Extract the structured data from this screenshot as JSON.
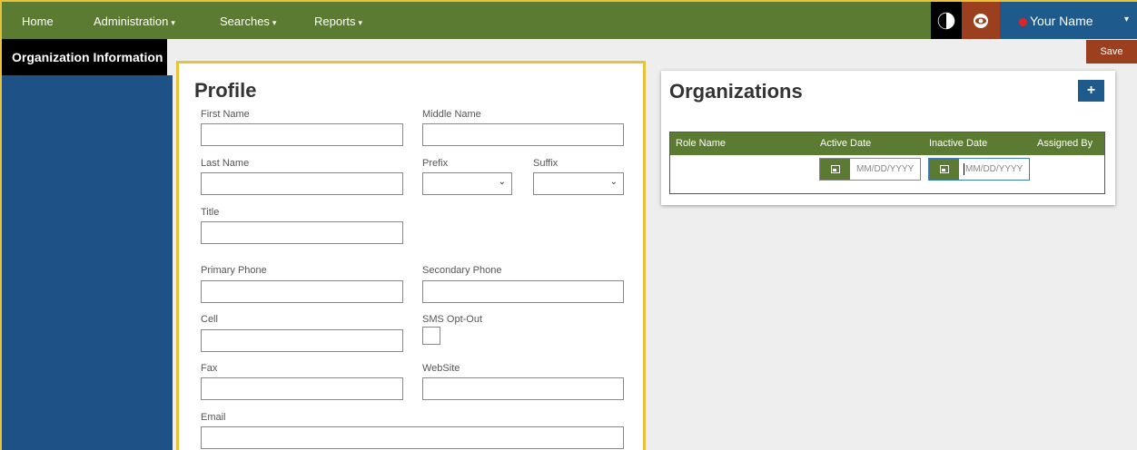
{
  "nav": {
    "home": "Home",
    "administration": "Administration",
    "searches": "Searches",
    "reports": "Reports",
    "caret": "▾",
    "user_name": "Your Name",
    "user_caret": "▾"
  },
  "sidebar": {
    "title": "Organization Information"
  },
  "toolbar": {
    "save_label": "Save"
  },
  "profile": {
    "title": "Profile",
    "fields": {
      "first_name": "First Name",
      "middle_name": "Middle Name",
      "last_name": "Last Name",
      "prefix": "Prefix",
      "suffix": "Suffix",
      "title": "Title",
      "primary_phone": "Primary Phone",
      "secondary_phone": "Secondary Phone",
      "cell": "Cell",
      "sms_opt_out": "SMS Opt-Out",
      "fax": "Fax",
      "website": "WebSite",
      "email": "Email"
    },
    "select_chevron": "⌄"
  },
  "organizations": {
    "title": "Organizations",
    "add_label": "+",
    "columns": [
      "Role Name",
      "Active Date",
      "Inactive Date",
      "Assigned By"
    ],
    "date_placeholder": "MM/DD/YYYY"
  },
  "colors": {
    "nav_green": "#5b7a32",
    "user_blue": "#1e5a8c",
    "save_brown": "#9c3f1e",
    "highlight_yellow": "#e8c33a",
    "sidebar_blue": "#1e5185"
  }
}
